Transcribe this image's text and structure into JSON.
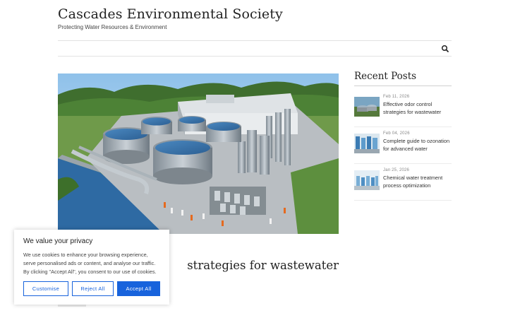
{
  "header": {
    "site_title": "Cascades Environmental Society",
    "tagline": "Protecting Water Resources & Environment"
  },
  "nav": {
    "search_icon": "search-icon"
  },
  "article": {
    "title_visible": "strategies for wastewater",
    "meta_text": "·  ·  ·"
  },
  "sidebar": {
    "widget_title": "Recent Posts",
    "posts": [
      {
        "date": "Feb 11, 2026",
        "title": "Effective odor control strategies for wastewater"
      },
      {
        "date": "Feb 04, 2026",
        "title": "Complete guide to ozonation for advanced water"
      },
      {
        "date": "Jan 25, 2026",
        "title": "Chemical water treatment process optimization"
      }
    ]
  },
  "cookie_banner": {
    "title": "We value your privacy",
    "text": "We use cookies to enhance your browsing experience, serve personalised ads or content, and analyse our traffic. By clicking \"Accept All\", you consent to our use of cookies.",
    "customise_label": "Customise",
    "reject_label": "Reject All",
    "accept_label": "Accept All",
    "accent_color": "#1863dc"
  }
}
